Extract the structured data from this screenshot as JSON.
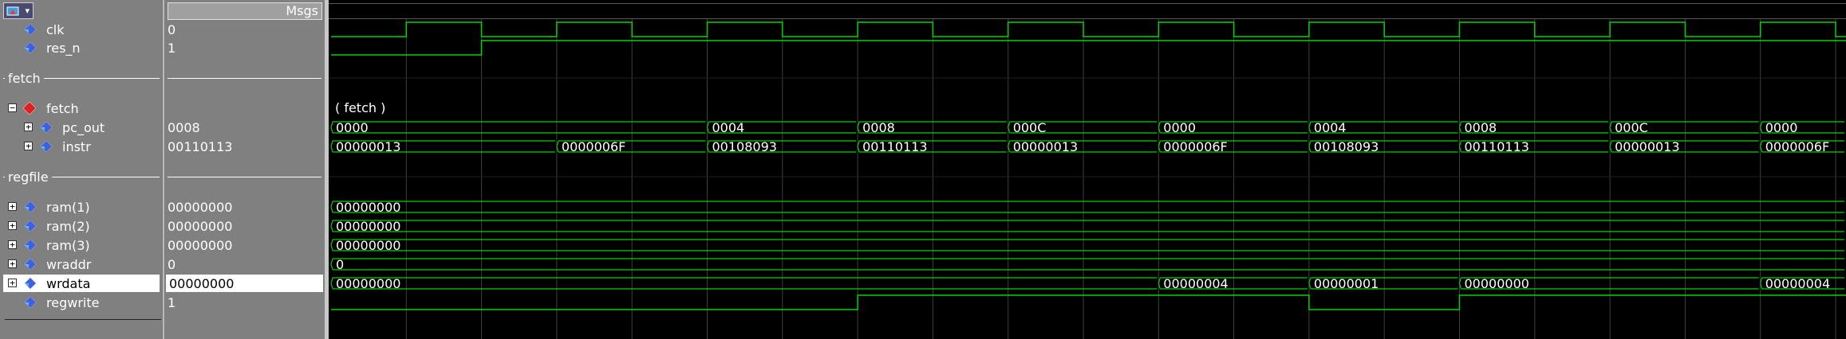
{
  "header": {
    "msgs_label": "Msgs"
  },
  "colors": {
    "wave": "#00d400",
    "grid": "#404040",
    "text": "#ffffff",
    "bg": "#000000",
    "panel": "#808080"
  },
  "signals": [
    {
      "id": "clk",
      "kind": "signal",
      "name": "clk",
      "value": "0",
      "expandable": false,
      "icon": "signal-diamond-icon"
    },
    {
      "id": "res_n",
      "kind": "signal",
      "name": "res_n",
      "value": "1",
      "expandable": false,
      "icon": "signal-diamond-icon"
    },
    {
      "id": "g_fetch",
      "kind": "group",
      "name": "fetch"
    },
    {
      "id": "fetch",
      "kind": "instance",
      "name": "fetch",
      "value": "",
      "expandable": true,
      "expanded": true,
      "icon": "instance-red-diamond-icon",
      "wave_text": "( fetch )"
    },
    {
      "id": "pc_out",
      "kind": "bus",
      "name": "pc_out",
      "value": "0008",
      "expandable": true,
      "icon": "bus-diamond-icon"
    },
    {
      "id": "instr",
      "kind": "bus",
      "name": "instr",
      "value": "00110113",
      "expandable": true,
      "icon": "bus-diamond-icon"
    },
    {
      "id": "g_regfile",
      "kind": "group",
      "name": "regfile"
    },
    {
      "id": "ram1",
      "kind": "bus",
      "name": "ram(1)",
      "value": "00000000",
      "expandable": true,
      "icon": "bus-diamond-icon"
    },
    {
      "id": "ram2",
      "kind": "bus",
      "name": "ram(2)",
      "value": "00000000",
      "expandable": true,
      "icon": "bus-diamond-icon"
    },
    {
      "id": "ram3",
      "kind": "bus",
      "name": "ram(3)",
      "value": "00000000",
      "expandable": true,
      "icon": "bus-diamond-icon"
    },
    {
      "id": "wraddr",
      "kind": "bus",
      "name": "wraddr",
      "value": "0",
      "expandable": true,
      "icon": "bus-diamond-icon"
    },
    {
      "id": "wrdata",
      "kind": "bus",
      "name": "wrdata",
      "value": "00000000",
      "expandable": true,
      "icon": "bus-diamond-icon",
      "selected": true
    },
    {
      "id": "regwrite",
      "kind": "signal",
      "name": "regwrite",
      "value": "1",
      "expandable": false,
      "icon": "signal-diamond-icon"
    }
  ],
  "waveforms": {
    "clk": {
      "type": "clock",
      "period_cycles": 1,
      "start_level": 0,
      "res_low_until_cycle": 1
    },
    "res_n": {
      "type": "bit",
      "transitions": [
        {
          "cycle": 0,
          "level": 0
        },
        {
          "cycle": 2,
          "level": 1
        }
      ]
    },
    "pc_out": {
      "type": "bus",
      "segments": [
        {
          "cycle": 0,
          "text": "0000"
        },
        {
          "cycle": 5,
          "text": "0004"
        },
        {
          "cycle": 7,
          "text": "0008"
        },
        {
          "cycle": 9,
          "text": "000C"
        },
        {
          "cycle": 11,
          "text": "0000"
        },
        {
          "cycle": 13,
          "text": "0004"
        },
        {
          "cycle": 15,
          "text": "0008"
        },
        {
          "cycle": 17,
          "text": "000C"
        },
        {
          "cycle": 19,
          "text": "0000"
        }
      ]
    },
    "instr": {
      "type": "bus",
      "segments": [
        {
          "cycle": 0,
          "text": "00000013"
        },
        {
          "cycle": 3,
          "text": "0000006F"
        },
        {
          "cycle": 5,
          "text": "00108093"
        },
        {
          "cycle": 7,
          "text": "00110113"
        },
        {
          "cycle": 9,
          "text": "00000013"
        },
        {
          "cycle": 11,
          "text": "0000006F"
        },
        {
          "cycle": 13,
          "text": "00108093"
        },
        {
          "cycle": 15,
          "text": "00110113"
        },
        {
          "cycle": 17,
          "text": "00000013"
        },
        {
          "cycle": 19,
          "text": "0000006F"
        }
      ]
    },
    "ram1": {
      "type": "bus",
      "segments": [
        {
          "cycle": 0,
          "text": "00000000"
        }
      ]
    },
    "ram2": {
      "type": "bus",
      "segments": [
        {
          "cycle": 0,
          "text": "00000000"
        }
      ]
    },
    "ram3": {
      "type": "bus",
      "segments": [
        {
          "cycle": 0,
          "text": "00000000"
        }
      ]
    },
    "wraddr": {
      "type": "bus",
      "segments": [
        {
          "cycle": 0,
          "text": "0"
        }
      ]
    },
    "wrdata": {
      "type": "bus",
      "segments": [
        {
          "cycle": 0,
          "text": "00000000"
        },
        {
          "cycle": 11,
          "text": "00000004"
        },
        {
          "cycle": 13,
          "text": "00000001"
        },
        {
          "cycle": 15,
          "text": "00000000"
        },
        {
          "cycle": 19,
          "text": "00000004"
        }
      ]
    },
    "regwrite": {
      "type": "bit",
      "transitions": [
        {
          "cycle": 0,
          "level": 0
        },
        {
          "cycle": 7,
          "level": 1
        },
        {
          "cycle": 13,
          "level": 0
        },
        {
          "cycle": 15,
          "level": 1
        }
      ]
    }
  }
}
